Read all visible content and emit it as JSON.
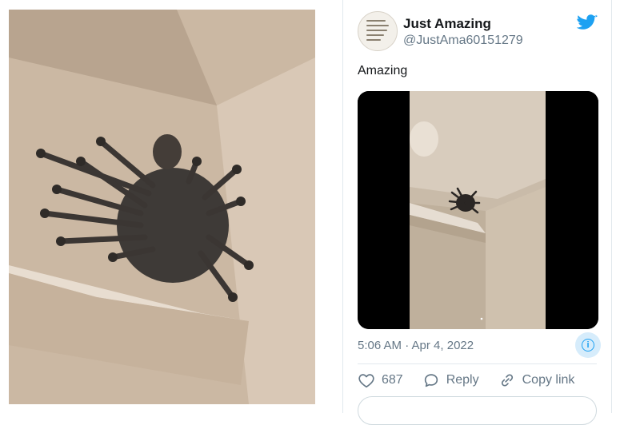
{
  "left_image": {
    "subject": "spider-like creature on wall shelf"
  },
  "tweet": {
    "display_name": "Just Amazing",
    "handle": "@JustAma60151279",
    "text": "Amazing",
    "timestamp": "5:06 AM · Apr 4, 2022",
    "likes_count": "687",
    "reply_label": "Reply",
    "copy_link_label": "Copy link",
    "info_glyph": "i"
  },
  "colors": {
    "twitter_blue": "#1da1f2",
    "secondary_text": "#657786",
    "primary_text": "#14171a"
  },
  "icons": {
    "brand": "twitter-bird-icon",
    "like": "heart-icon",
    "reply": "speech-bubble-icon",
    "copy_link": "link-icon",
    "info": "info-icon"
  }
}
